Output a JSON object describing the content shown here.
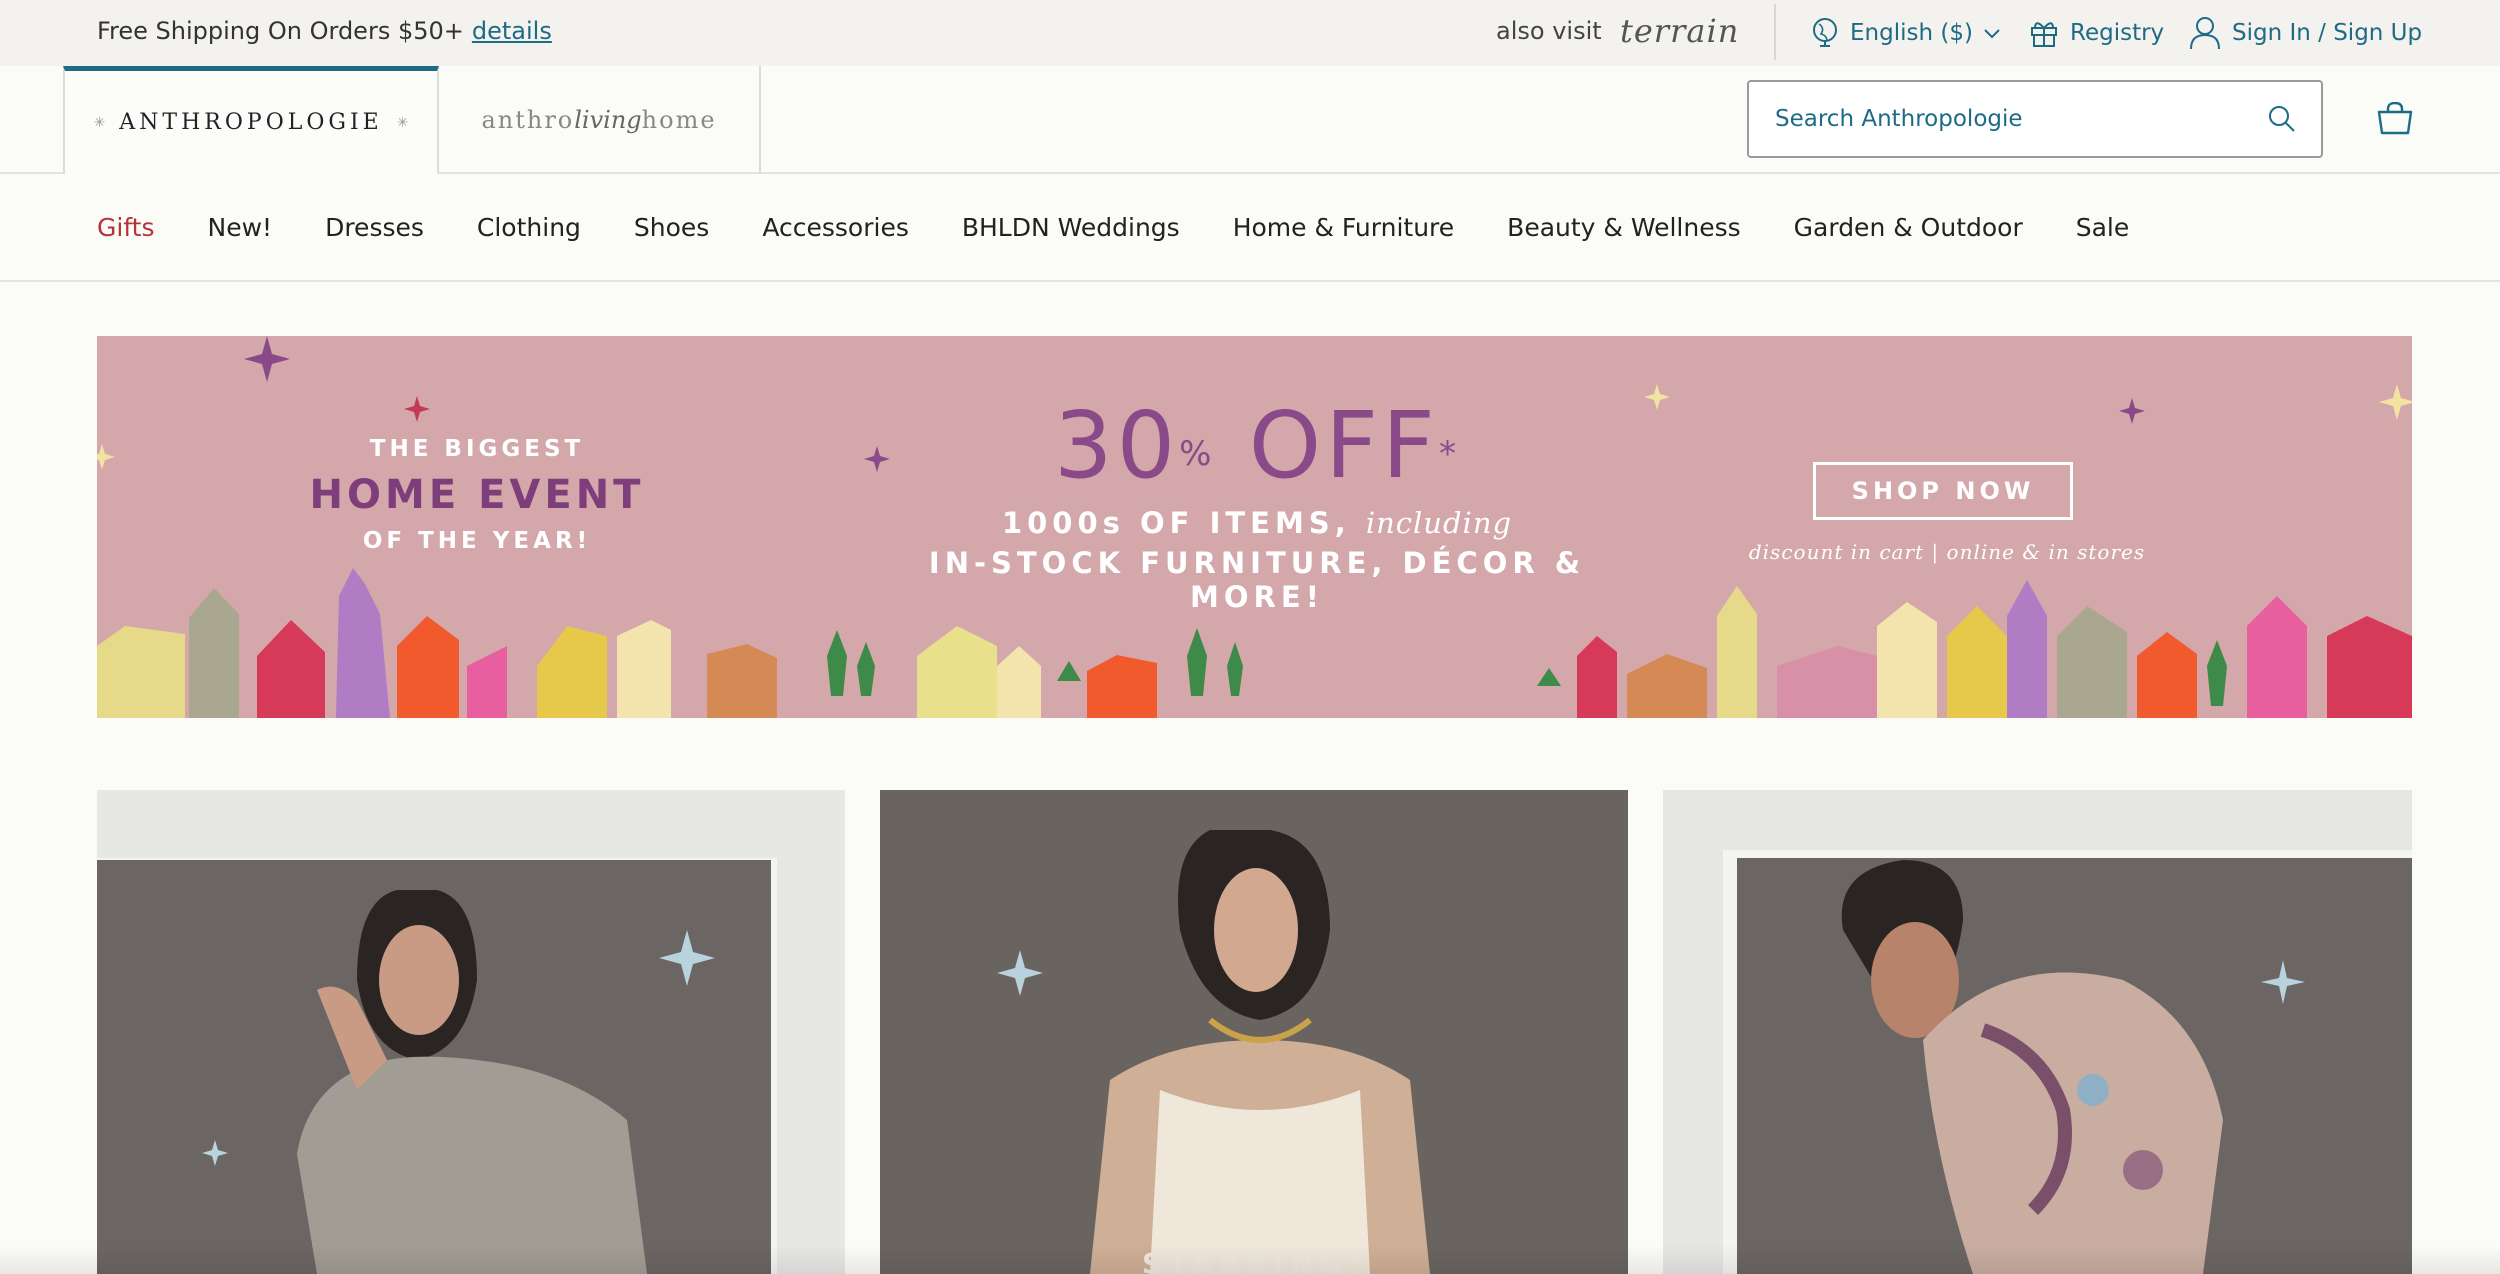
{
  "topbar": {
    "promo_text": "Free Shipping On Orders $50+",
    "promo_link": "details",
    "also_visit": "also visit",
    "terrain": "terrain",
    "language": "English ($)",
    "registry": "Registry",
    "sign_in": "Sign In / Sign Up"
  },
  "brands": {
    "anthropologie": "ANTHROPOLOGIE",
    "living_prefix": "anthro",
    "living_script": "living",
    "living_suffix": "home"
  },
  "search": {
    "placeholder": "Search Anthropologie"
  },
  "nav": {
    "items": [
      "Gifts",
      "New!",
      "Dresses",
      "Clothing",
      "Shoes",
      "Accessories",
      "BHLDN Weddings",
      "Home & Furniture",
      "Beauty & Wellness",
      "Garden & Outdoor",
      "Sale"
    ]
  },
  "banner": {
    "left_line1": "THE BIGGEST",
    "left_line2": "HOME EVENT",
    "left_line3": "OF THE YEAR!",
    "percent": "30",
    "percent_sign": "%",
    "off": "OFF",
    "asterisk": "*",
    "mid_line1": "1000s OF ITEMS,",
    "mid_line1_italic": "including",
    "mid_line2": "IN-STOCK FURNITURE, DÉCOR & MORE!",
    "cta": "SHOP NOW",
    "cta_sub": "discount in cart | online & in stores"
  },
  "tiles": {
    "caption_partial": "STARRING:"
  },
  "colors": {
    "accent": "#1e6b85",
    "gifts_red": "#b8323b",
    "banner_pink": "#d4a7ab",
    "banner_purple": "#7e3e7c"
  },
  "icons": {
    "globe": "globe-icon",
    "gift": "gift-icon",
    "user": "user-icon",
    "search": "search-icon",
    "cart": "shopping-bag-icon"
  }
}
